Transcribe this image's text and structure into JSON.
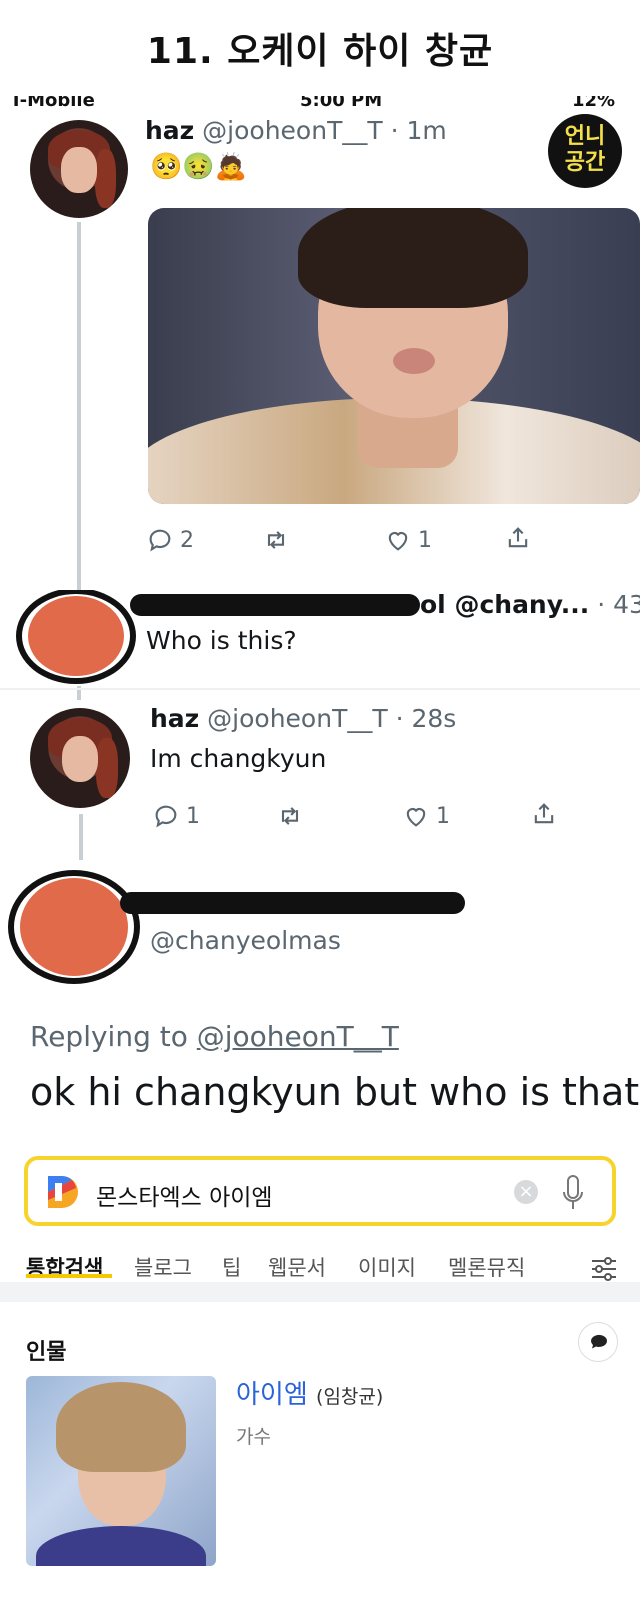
{
  "page": {
    "title": "11. 오케이 하이 창균"
  },
  "status_bar": {
    "carrier": "T-Mobile",
    "time": "5:00 PM",
    "battery": "12%"
  },
  "badge": {
    "line1": "언니",
    "line2": "공간"
  },
  "tweet1": {
    "name": "haz",
    "handle": "@jooheonT__T",
    "time": "· 1m",
    "emojis": "🥺🤢🙇",
    "replies": "2",
    "likes": "1"
  },
  "reply1": {
    "handle": "ol @chany...",
    "time": "· 43",
    "text": "Who is this?"
  },
  "tweet2": {
    "name": "haz",
    "handle": "@jooheonT__T",
    "time": "· 28s",
    "text": "Im changkyun",
    "replies": "1",
    "likes": "1"
  },
  "reply2": {
    "handle": "@chanyeolmas",
    "replying_prefix": "Replying to",
    "replying_to": "@jooheonT__T",
    "text": "ok hi changkyun but who is that"
  },
  "search": {
    "query": "몬스타엑스 아이엠",
    "tabs": [
      "통합검색",
      "블로그",
      "팁",
      "웹문서",
      "이미지",
      "멜론뮤직"
    ],
    "section": "인물",
    "person_name": "아이엠",
    "person_real_name": "(임창균)",
    "person_job": "가수"
  },
  "colors": {
    "accent": "#f6d32d",
    "link": "#2b64d8"
  }
}
